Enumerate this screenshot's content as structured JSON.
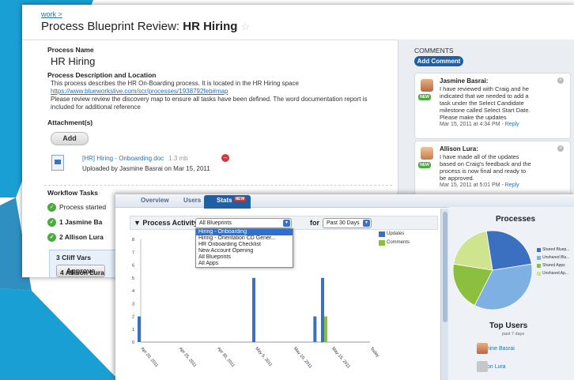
{
  "page": {
    "breadcrumb": "work >",
    "title_prefix": "Process Blueprint Review: ",
    "title_bold": "HR Hiring"
  },
  "process": {
    "name_label": "Process Name",
    "name": "HR Hiring",
    "desc_label": "Process Description and Location",
    "desc_line1": "This process describes the HR On-Boarding process. It is located in the HR Hiring space",
    "desc_link": "https://www.blueworkslive.com/scr/processes/1938792feb#map",
    "desc_line2": "Please review review the discovery map to ensure all tasks have been defined. The word documentation report is",
    "desc_line3": "included for additional reference",
    "attachments_label": "Attachment(s)",
    "add_label": "Add",
    "attachment_name": "[HR] Hiring - Onboarding.doc",
    "attachment_size": "1.3 mb",
    "attachment_uploaded": "Uploaded by Jasmine Basrai on Mar 15, 2011"
  },
  "workflow": {
    "label": "Workflow Tasks",
    "started": "Process started",
    "task1": "1 Jasmine Ba",
    "task2": "2 Allison Lura",
    "task3": "3 Cliff Vars",
    "approve_label": "Approve",
    "task4": "4 Allison Lura"
  },
  "comments": {
    "header": "COMMENTS",
    "add_label": "Add Comment",
    "items": [
      {
        "author": "Jasmine Basrai:",
        "lines": [
          "I have reviewed with Craig and he",
          "indicated that we needed to add a",
          "task under the Select Candidate",
          "milestone called Select Start Date.",
          "Please make the updates"
        ],
        "date": "Mar 15, 2011 at 4:34 PM - ",
        "reply": "Reply",
        "badge": "NEW"
      },
      {
        "author": "Allison Lura:",
        "lines": [
          "I have made all of the updates",
          "based on Craig's feedback and the",
          "process is now final and ready to",
          "be approved."
        ],
        "date": "Mar 15, 2011 at 5:01 PM - ",
        "reply": "Reply",
        "badge": "NEW"
      }
    ]
  },
  "stats": {
    "tabs": {
      "overview": "Overview",
      "users": "Users",
      "stats": "Stats",
      "new_badge": "NEW"
    },
    "activity_label": "Process Activity",
    "blueprint_select": "All Blueprints",
    "for_label": "for",
    "period_select": "Past 30 Days",
    "dropdown_options": [
      "Hiring - Onboarding",
      "Hiring - Orientation CD Gener...",
      "HR Onboarding Checklist",
      "New Account Opening",
      "All Blueprints",
      "All Apps"
    ],
    "dropdown_selected": 0
  },
  "chart_data": [
    {
      "type": "bar",
      "title": "",
      "xlabel": "",
      "ylabel": "",
      "ylim": [
        0,
        8
      ],
      "yticks": [
        0,
        1,
        2,
        3,
        4,
        5,
        6,
        7,
        8
      ],
      "x_tick_labels": [
        "Apr 20, 2011",
        "Apr 25, 2011",
        "Apr 30, 2011",
        "May 5, 2011",
        "May 10, 2011",
        "May 15, 2011",
        "Today"
      ],
      "legend": [
        "Updates",
        "Comments"
      ],
      "legend_position": "top-right",
      "colors": {
        "Updates": "#3b6fc0",
        "Comments": "#8cbf3f"
      },
      "series": [
        {
          "name": "Updates",
          "points": [
            [
              "Apr 20, 2011",
              2
            ],
            [
              "May 5, 2011",
              5
            ],
            [
              "May 13, 2011",
              2
            ],
            [
              "May 14, 2011",
              5
            ]
          ]
        },
        {
          "name": "Comments",
          "points": [
            [
              "May 14, 2011",
              2
            ]
          ]
        }
      ],
      "x_range": [
        "Apr 20, 2011",
        "May 20, 2011"
      ]
    },
    {
      "type": "pie",
      "title": "Processes",
      "labels": [
        "Shared Bluep...",
        "Unshared Blu...",
        "Shared Apps",
        "Unshared Ap..."
      ],
      "values": [
        25,
        35,
        20,
        20
      ],
      "colors": [
        "#3b6fc0",
        "#7fb0e3",
        "#8cbf3f",
        "#cfe48f"
      ]
    }
  ],
  "top_users": {
    "title": "Top Users",
    "subtitle": "past 7 days",
    "users": [
      "Jasmine Basrai",
      "Allison Lura"
    ]
  }
}
